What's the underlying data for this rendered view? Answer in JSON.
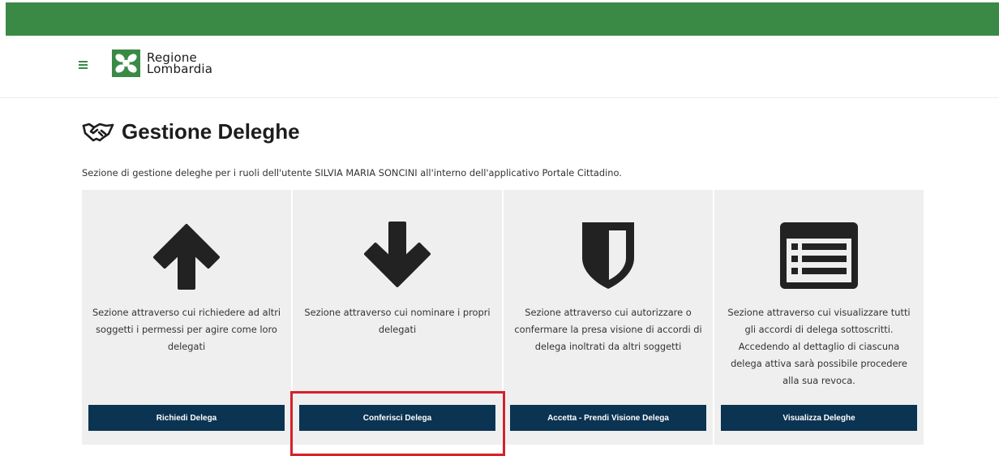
{
  "header": {
    "logo_line1": "Regione",
    "logo_line2": "Lombardia",
    "brand_color": "#3a8a45",
    "menu_icon": "hamburger-icon"
  },
  "page": {
    "title": "Gestione Deleghe",
    "title_icon": "handshake-icon",
    "subtitle": "Sezione di gestione deleghe per i ruoli dell'utente SILVIA MARIA SONCINI all'interno dell'applicativo Portale Cittadino."
  },
  "cards": [
    {
      "icon": "arrow-up-icon",
      "description": "Sezione attraverso cui richiedere ad altri soggetti i permessi per agire come loro delegati",
      "button": "Richiedi Delega"
    },
    {
      "icon": "arrow-down-icon",
      "description": "Sezione attraverso cui nominare i propri delegati",
      "button": "Conferisci Delega"
    },
    {
      "icon": "shield-icon",
      "description": "Sezione attraverso cui autorizzare o confermare la presa visione di accordi di delega inoltrati da altri soggetti",
      "button": "Accetta - Prendi Visione Delega"
    },
    {
      "icon": "list-icon",
      "description": "Sezione attraverso cui visualizzare tutti gli accordi di delega sottoscritti. Accedendo al dettaglio di ciascuna delega attiva sarà possibile procedere alla sua revoca.",
      "button": "Visualizza Deleghe"
    }
  ],
  "colors": {
    "button_bg": "#0b3352",
    "card_bg": "#efefef",
    "highlight": "#d6202a"
  }
}
